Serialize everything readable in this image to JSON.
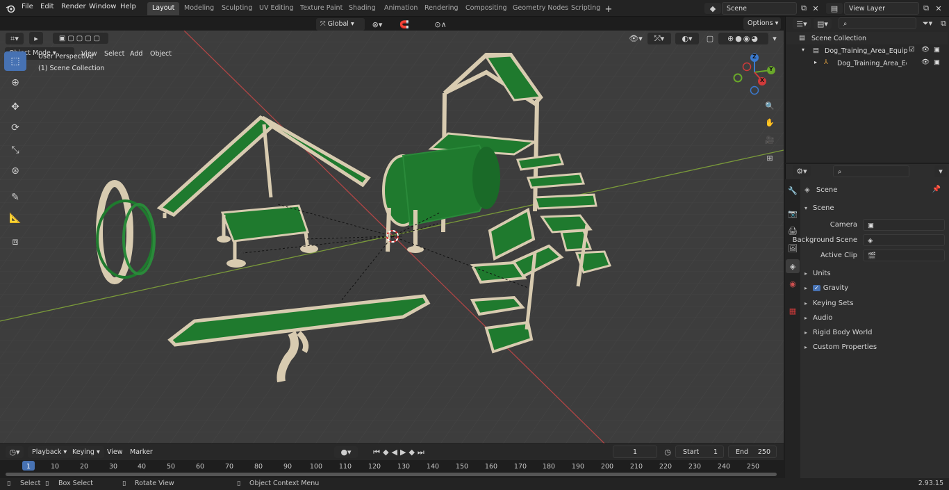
{
  "app": {
    "version": "2.93.15"
  },
  "menu": [
    "File",
    "Edit",
    "Render",
    "Window",
    "Help"
  ],
  "workspaces": [
    "Layout",
    "Modeling",
    "Sculpting",
    "UV Editing",
    "Texture Paint",
    "Shading",
    "Animation",
    "Rendering",
    "Compositing",
    "Geometry Nodes",
    "Scripting"
  ],
  "active_workspace": "Layout",
  "scene_field": "Scene",
  "view_layer_field": "View Layer",
  "viewport": {
    "mode": "Object Mode",
    "menus": [
      "View",
      "Select",
      "Add",
      "Object"
    ],
    "orientation": "Global",
    "options_label": "Options",
    "overlay_line1": "User Perspective",
    "overlay_line2": "(1) Scene Collection"
  },
  "gizmo": {
    "x": "X",
    "y": "Y",
    "z": "Z"
  },
  "outliner": {
    "root": "Scene Collection",
    "items": [
      "Dog_Training_Area_Equipmer",
      "Dog_Training_Area_Equip"
    ]
  },
  "properties": {
    "context": "Scene",
    "section": "Scene",
    "camera_label": "Camera",
    "background_label": "Background Scene",
    "clip_label": "Active Clip",
    "panels": [
      "Units",
      "Gravity",
      "Keying Sets",
      "Audio",
      "Rigid Body World",
      "Custom Properties"
    ]
  },
  "timeline": {
    "menus": [
      "Playback",
      "Keying",
      "View",
      "Marker"
    ],
    "current_frame": "1",
    "start_label": "Start",
    "start_value": "1",
    "end_label": "End",
    "end_value": "250",
    "ruler": [
      "1",
      "10",
      "20",
      "30",
      "40",
      "50",
      "60",
      "70",
      "80",
      "90",
      "100",
      "110",
      "120",
      "130",
      "140",
      "150",
      "160",
      "170",
      "180",
      "190",
      "200",
      "210",
      "220",
      "230",
      "240",
      "250"
    ]
  },
  "status": {
    "select": "Select",
    "box_select": "Box Select",
    "rotate": "Rotate View",
    "context_menu": "Object Context Menu"
  },
  "colors": {
    "accent": "#4772b3",
    "equipment_green": "#1f7a2e",
    "frame_beige": "#d8cbb0"
  }
}
